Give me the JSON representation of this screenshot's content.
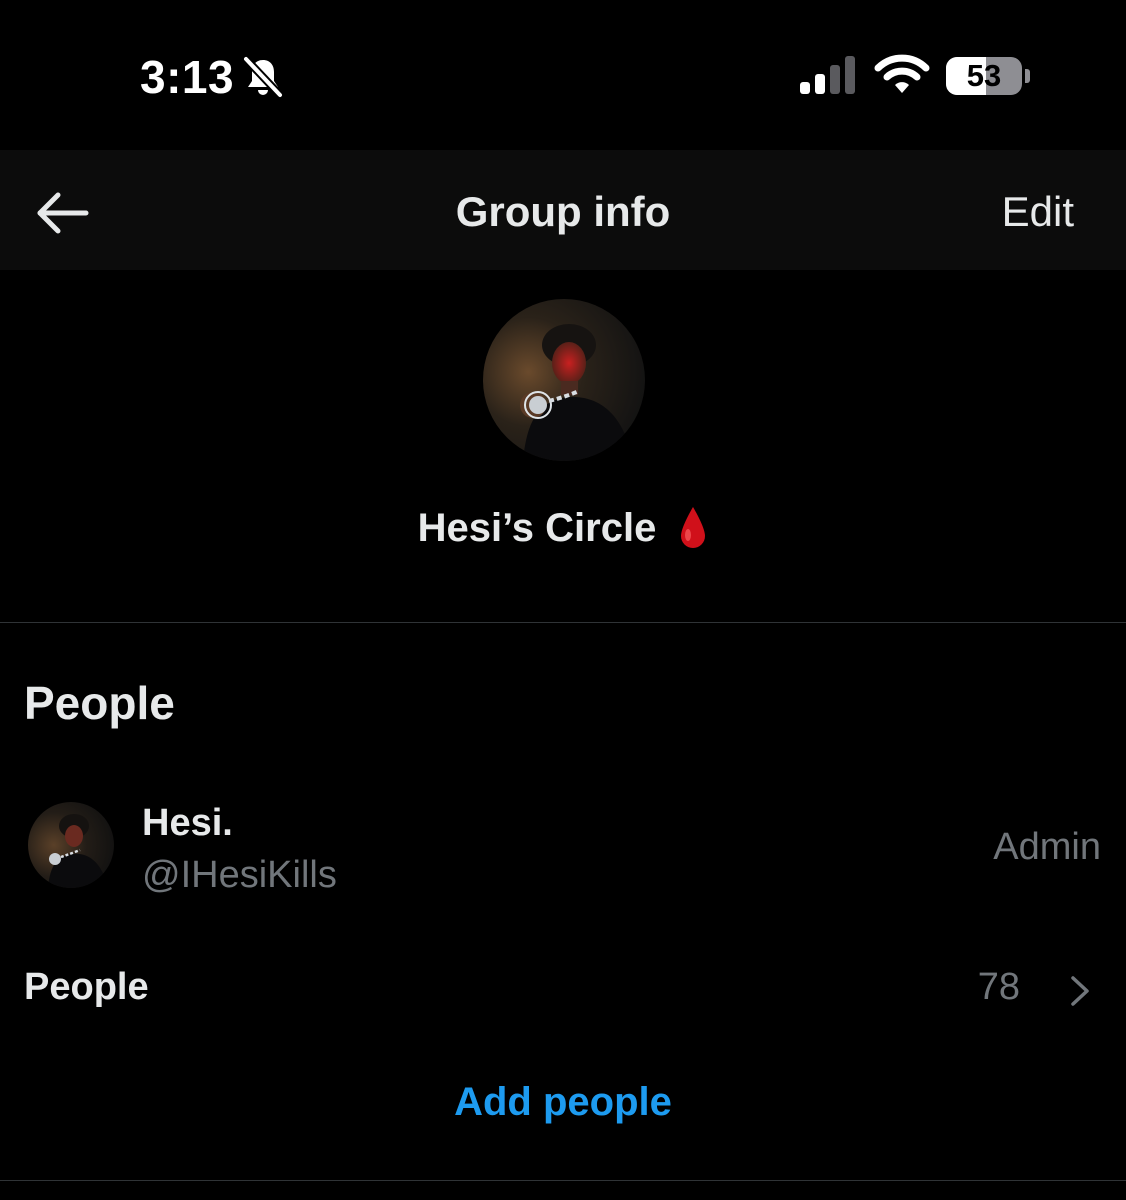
{
  "status_bar": {
    "time": "3:13",
    "mute_icon": "bell-slash-icon",
    "signal_icon": "cellular-signal-icon",
    "signal_bars_active": 2,
    "signal_bars_total": 4,
    "wifi_icon": "wifi-icon",
    "battery_level": "53",
    "battery_fraction": 0.53
  },
  "header": {
    "back_icon": "arrow-left-icon",
    "title": "Group info",
    "edit_label": "Edit"
  },
  "group": {
    "avatar_icon": "group-avatar-photo",
    "name": "Hesi’s Circle",
    "emoji_icon": "drop-of-blood-icon"
  },
  "people_section": {
    "title": "People",
    "members": [
      {
        "name": "Hesi.",
        "handle": "@IHesiKills",
        "role": "Admin",
        "avatar_icon": "user-avatar-photo"
      }
    ],
    "people_row": {
      "label": "People",
      "count": "78",
      "chevron_icon": "chevron-right-icon"
    },
    "add_people_label": "Add people"
  },
  "colors": {
    "background": "#000000",
    "header_background": "#0c0c0c",
    "primary_text": "#e7e9ea",
    "secondary_text": "#71767b",
    "accent": "#1d9bf0",
    "divider": "#2f3336",
    "drop": "#d0101a"
  }
}
